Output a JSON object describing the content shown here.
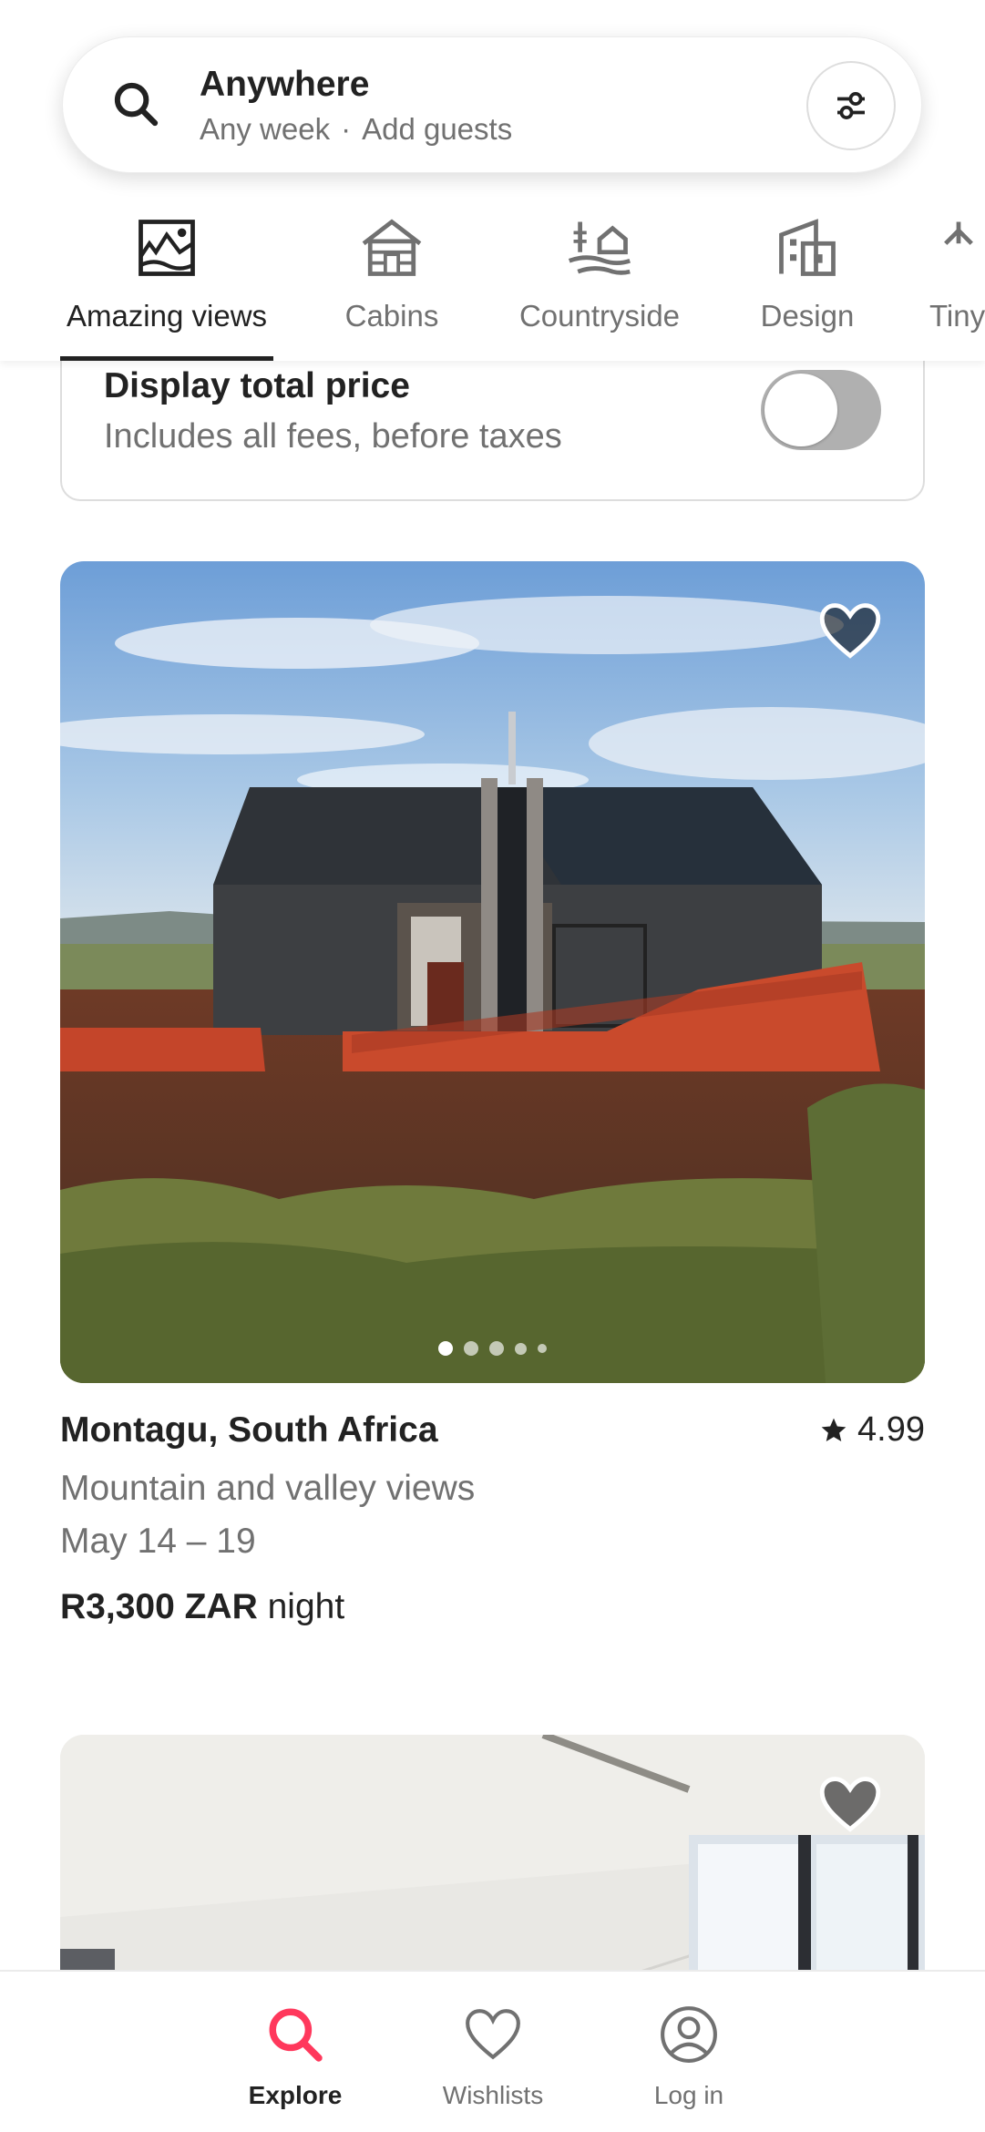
{
  "search": {
    "title": "Anywhere",
    "week": "Any week",
    "separator": "·",
    "guests": "Add guests"
  },
  "categories": [
    {
      "label": "Amazing views",
      "icon": "amazing-views-icon",
      "active": true
    },
    {
      "label": "Cabins",
      "icon": "cabin-icon",
      "active": false
    },
    {
      "label": "Countryside",
      "icon": "countryside-icon",
      "active": false
    },
    {
      "label": "Design",
      "icon": "design-icon",
      "active": false
    },
    {
      "label": "Tiny",
      "icon": "tiny-home-icon",
      "active": false
    }
  ],
  "price_toggle": {
    "title": "Display total price",
    "subtitle": "Includes all fees, before taxes",
    "on": false
  },
  "listings": [
    {
      "location": "Montagu, South Africa",
      "rating": "4.99",
      "description": "Mountain and valley views",
      "dates": "May 14 – 19",
      "price": "R3,300 ZAR",
      "price_unit": "night",
      "photo_count_dots": 5,
      "active_photo_index": 0
    },
    {
      "photo": "interior-photo"
    }
  ],
  "nav": {
    "explore": "Explore",
    "wishlists": "Wishlists",
    "login": "Log in"
  },
  "colors": {
    "brand": "#FF385C",
    "text_primary": "#222222",
    "text_secondary": "#717171"
  }
}
